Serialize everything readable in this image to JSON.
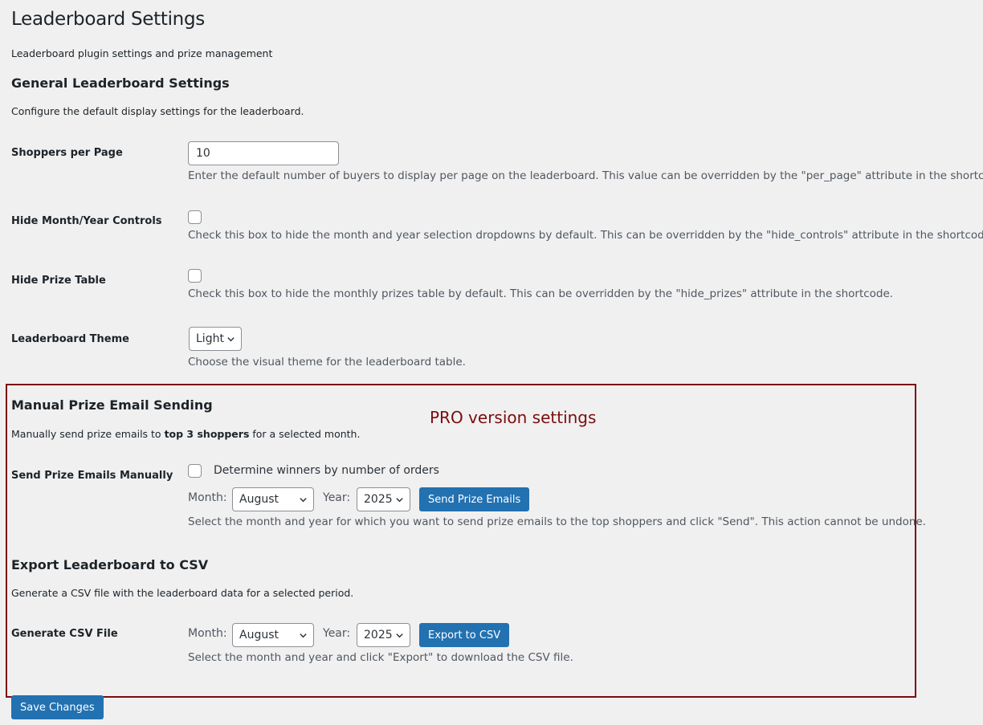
{
  "page": {
    "title": "Leaderboard Settings",
    "subtitle": "Leaderboard plugin settings and prize management"
  },
  "general": {
    "heading": "General Leaderboard Settings",
    "description": "Configure the default display settings for the leaderboard.",
    "shoppers_per_page": {
      "label": "Shoppers per Page",
      "value": "10",
      "description": "Enter the default number of buyers to display per page on the leaderboard. This value can be overridden by the \"per_page\" attribute in the shortcode."
    },
    "hide_controls": {
      "label": "Hide Month/Year Controls",
      "checked": false,
      "description": "Check this box to hide the month and year selection dropdowns by default. This can be overridden by the \"hide_controls\" attribute in the shortcode."
    },
    "hide_prizes": {
      "label": "Hide Prize Table",
      "checked": false,
      "description": "Check this box to hide the monthly prizes table by default. This can be overridden by the \"hide_prizes\" attribute in the shortcode."
    },
    "theme": {
      "label": "Leaderboard Theme",
      "value": "Light",
      "description": "Choose the visual theme for the leaderboard table."
    }
  },
  "pro_label": "PRO version settings",
  "manual_email": {
    "heading": "Manual Prize Email Sending",
    "description_pre": "Manually send prize emails to ",
    "description_bold": "top 3 shoppers",
    "description_post": " for a selected month.",
    "row_label": "Send Prize Emails Manually",
    "checkbox_label": "Determine winners by number of orders",
    "month_label": "Month:",
    "month_value": "August",
    "year_label": "Year:",
    "year_value": "2025",
    "button": "Send Prize Emails",
    "help": "Select the month and year for which you want to send prize emails to the top shoppers and click \"Send\". This action cannot be undone."
  },
  "export": {
    "heading": "Export Leaderboard to CSV",
    "description": "Generate a CSV file with the leaderboard data for a selected period.",
    "row_label": "Generate CSV File",
    "month_label": "Month:",
    "month_value": "August",
    "year_label": "Year:",
    "year_value": "2025",
    "button": "Export to CSV",
    "help": "Select the month and year and click \"Export\" to download the CSV file."
  },
  "save_button": "Save Changes",
  "colors": {
    "background": "#f0f0f1",
    "primary": "#2271b1",
    "pro_accent": "#7b0d0d"
  }
}
